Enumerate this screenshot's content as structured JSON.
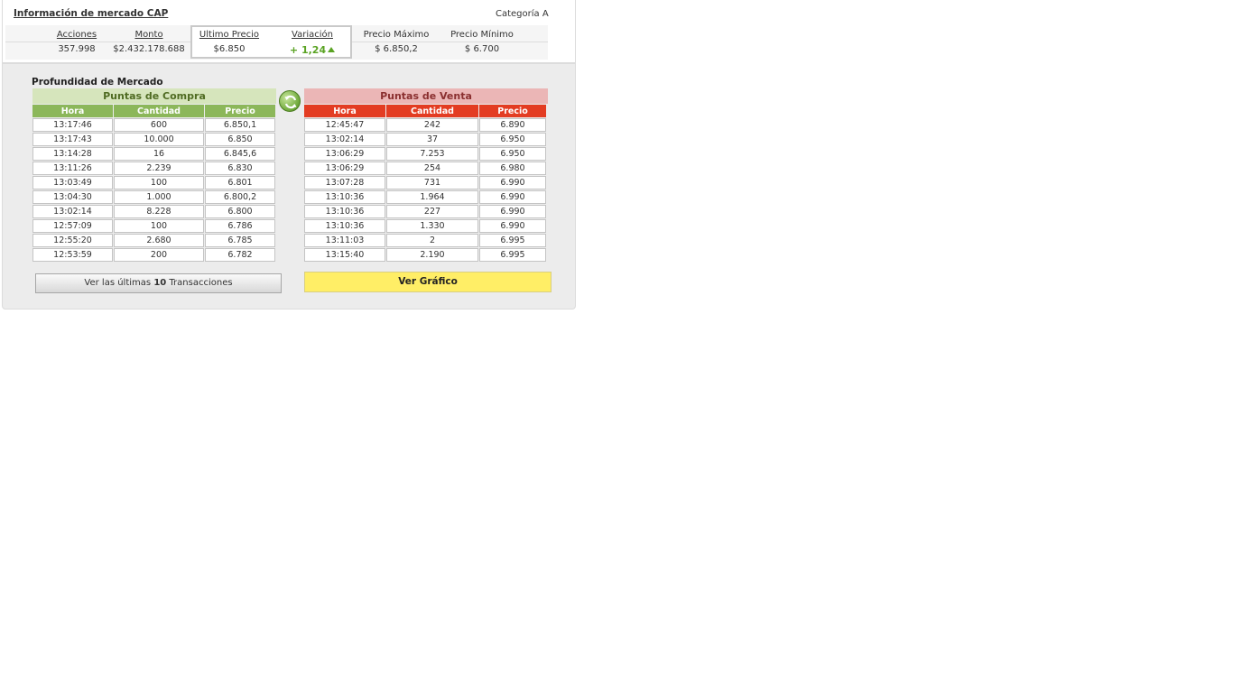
{
  "header": {
    "title": "Información de mercado CAP",
    "category": "Categoría A"
  },
  "stats": {
    "acciones_label": "Acciones",
    "acciones_value": "357.998",
    "monto_label": "Monto",
    "monto_value": "$2.432.178.688",
    "ultimo_label": "Ultimo Precio",
    "ultimo_value": "$6.850",
    "variacion_label": "Variación",
    "variacion_value": "+ 1,24",
    "maximo_label": "Precio Máximo",
    "maximo_value": "$ 6.850,2",
    "minimo_label": "Precio Mínimo",
    "minimo_value": "$ 6.700"
  },
  "depth": {
    "title": "Profundidad de Mercado",
    "columns": [
      "Hora",
      "Cantidad",
      "Precio"
    ],
    "buy": {
      "title": "Puntas de Compra",
      "rows": [
        [
          "13:17:46",
          "600",
          "6.850,1"
        ],
        [
          "13:17:43",
          "10.000",
          "6.850"
        ],
        [
          "13:14:28",
          "16",
          "6.845,6"
        ],
        [
          "13:11:26",
          "2.239",
          "6.830"
        ],
        [
          "13:03:49",
          "100",
          "6.801"
        ],
        [
          "13:04:30",
          "1.000",
          "6.800,2"
        ],
        [
          "13:02:14",
          "8.228",
          "6.800"
        ],
        [
          "12:57:09",
          "100",
          "6.786"
        ],
        [
          "12:55:20",
          "2.680",
          "6.785"
        ],
        [
          "12:53:59",
          "200",
          "6.782"
        ]
      ]
    },
    "sell": {
      "title": "Puntas de Venta",
      "rows": [
        [
          "12:45:47",
          "242",
          "6.890"
        ],
        [
          "13:02:14",
          "37",
          "6.950"
        ],
        [
          "13:06:29",
          "7.253",
          "6.950"
        ],
        [
          "13:06:29",
          "254",
          "6.980"
        ],
        [
          "13:07:28",
          "731",
          "6.990"
        ],
        [
          "13:10:36",
          "1.964",
          "6.990"
        ],
        [
          "13:10:36",
          "227",
          "6.990"
        ],
        [
          "13:10:36",
          "1.330",
          "6.990"
        ],
        [
          "13:11:03",
          "2",
          "6.995"
        ],
        [
          "13:15:40",
          "2.190",
          "6.995"
        ]
      ]
    }
  },
  "buttons": {
    "transactions_pre": "Ver las últimas",
    "transactions_num": "10",
    "transactions_post": "Transacciones",
    "graph": "Ver Gráfico"
  },
  "icons": {
    "refresh": "refresh-icon",
    "variation_trend": "triangle-up-icon"
  },
  "colors": {
    "buy_header": "#8cb75a",
    "sell_header": "#e33c22",
    "graph_button": "#ffee66",
    "positive": "#5aa323"
  }
}
